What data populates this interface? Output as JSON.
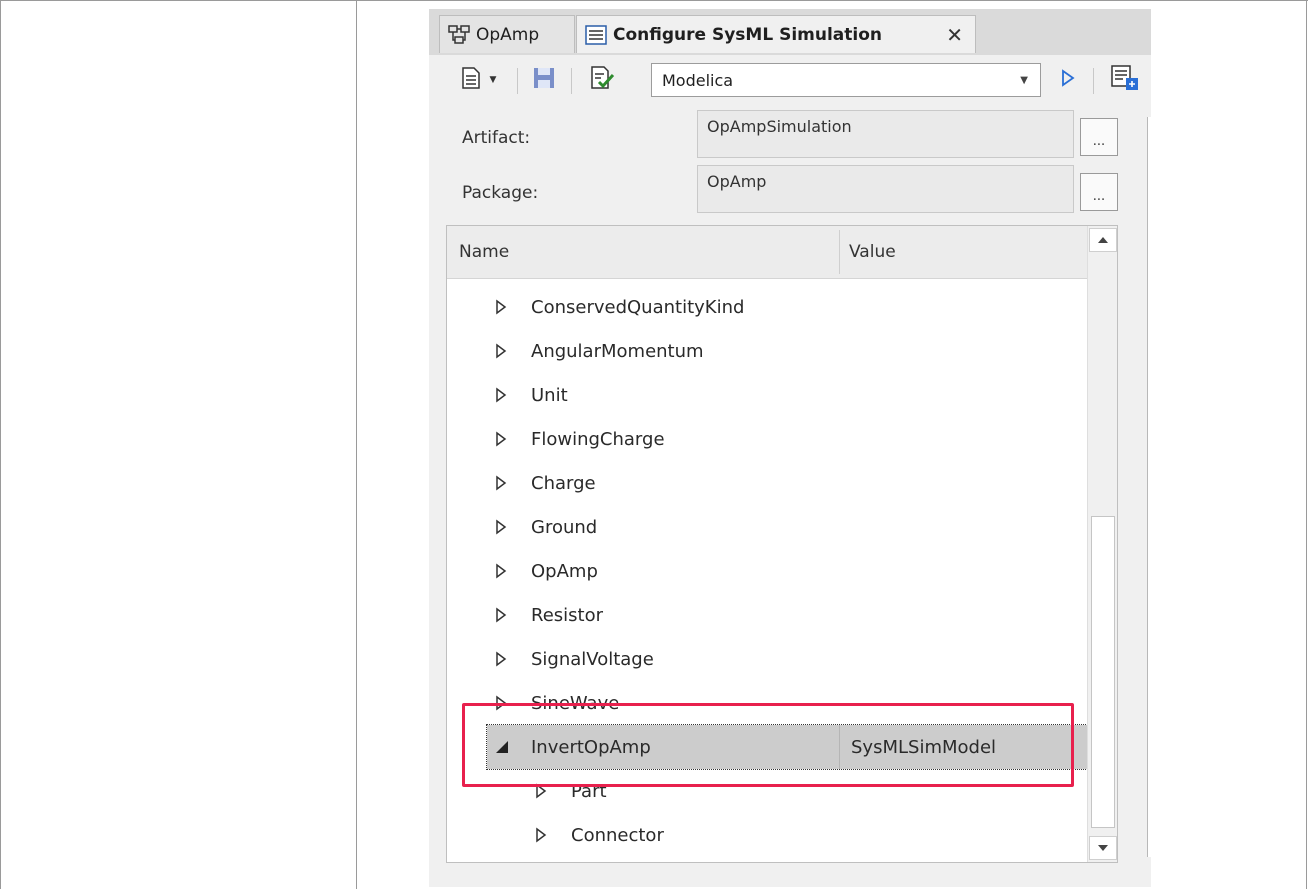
{
  "tabs": [
    {
      "label": "OpAmp",
      "icon": "diagram-icon"
    },
    {
      "label": "Configure SysML Simulation",
      "icon": "document-list-icon",
      "close": "✕"
    }
  ],
  "toolbar": {
    "combo_value": "Modelica",
    "icons": [
      "new-document-icon",
      "save-icon",
      "validate-icon",
      "run-icon",
      "generate-icon"
    ]
  },
  "form": {
    "artifact_label": "Artifact:",
    "artifact_value": "OpAmpSimulation",
    "package_label": "Package:",
    "package_value": "OpAmp",
    "browse": "..."
  },
  "grid": {
    "columns": [
      "Name",
      "Value"
    ],
    "rows": [
      {
        "name": "ConservedQuantityKind",
        "value": "",
        "expanded": false,
        "level": 1
      },
      {
        "name": "AngularMomentum",
        "value": "",
        "expanded": false,
        "level": 1
      },
      {
        "name": "Unit",
        "value": "",
        "expanded": false,
        "level": 1
      },
      {
        "name": "FlowingCharge",
        "value": "",
        "expanded": false,
        "level": 1
      },
      {
        "name": "Charge",
        "value": "",
        "expanded": false,
        "level": 1
      },
      {
        "name": "Ground",
        "value": "",
        "expanded": false,
        "level": 1
      },
      {
        "name": "OpAmp",
        "value": "",
        "expanded": false,
        "level": 1
      },
      {
        "name": "Resistor",
        "value": "",
        "expanded": false,
        "level": 1
      },
      {
        "name": "SignalVoltage",
        "value": "",
        "expanded": false,
        "level": 1
      },
      {
        "name": "SineWave",
        "value": "",
        "expanded": false,
        "level": 1
      },
      {
        "name": "InvertOpAmp",
        "value": "SysMLSimModel",
        "expanded": true,
        "level": 1,
        "selected": true
      },
      {
        "name": "Part",
        "value": "",
        "expanded": false,
        "level": 2
      },
      {
        "name": "Connector",
        "value": "",
        "expanded": false,
        "level": 2
      }
    ]
  },
  "colors": {
    "highlight": "#e8204d",
    "selected_row": "#cccccc"
  }
}
